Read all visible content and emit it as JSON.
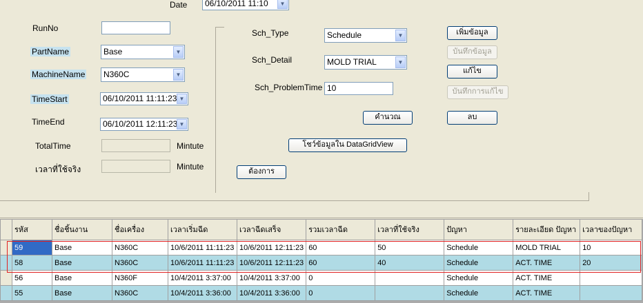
{
  "form": {
    "date_label": "Date",
    "date_value": "06/10/2011 11:10",
    "runno_label": "RunNo",
    "runno_value": "",
    "partname_label": "PartName",
    "partname_value": "Base",
    "machinename_label": "MachineName",
    "machinename_value": "N360C",
    "timestart_label": "TimeStart",
    "timestart_value": "06/10/2011 11:11:23",
    "timeend_label": "TimeEnd",
    "timeend_value": "06/10/2011 12:11:23",
    "totaltime_label": "TotalTime",
    "totaltime_value": "",
    "totaltime_unit": "Mintute",
    "realtime_label": "เวลาที่ใช้จริง",
    "realtime_value": "",
    "realtime_unit": "Mintute",
    "sch_type_label": "Sch_Type",
    "sch_type_value": "Schedule",
    "sch_detail_label": "Sch_Detail",
    "sch_detail_value": "MOLD TRIAL",
    "sch_problemtime_label": "Sch_ProblemTime",
    "sch_problemtime_value": "10"
  },
  "buttons": {
    "add": "เพิ่มข้อมูล",
    "save": "บันทึกข้อมูล",
    "edit": "แก้ไข",
    "save_edit": "บันทึกการแก้ไข",
    "calculate": "คำนวณ",
    "delete": "ลบ",
    "show_grid": "โชว์ข้อมูลใน DataGridView",
    "want": "ต้องการ"
  },
  "grid": {
    "headers": [
      "รหัส",
      "ชื่อชิ้นงาน",
      "ชื่อเครื่อง",
      "เวลาเริ่มฉีด",
      "เวลาฉีดเสร็จ",
      "รวมเวลาฉีด",
      "เวลาที่ใช้จริง",
      "ปัญหา",
      "รายละเอียด ปัญหา",
      "เวลาของปัญหา"
    ],
    "rows": [
      [
        "59",
        "Base",
        "N360C",
        "10/6/2011 11:11:23",
        "10/6/2011 12:11:23",
        "60",
        "50",
        "Schedule",
        "MOLD TRIAL",
        "10"
      ],
      [
        "58",
        "Base",
        "N360C",
        "10/6/2011 11:11:23",
        "10/6/2011 12:11:23",
        "60",
        "40",
        "Schedule",
        "ACT. TIME",
        "20"
      ],
      [
        "56",
        "Base",
        "N360F",
        "10/4/2011 3:37:00",
        "10/4/2011 3:37:00",
        "0",
        "",
        "Schedule",
        "ACT. TIME",
        ""
      ],
      [
        "55",
        "Base",
        "N360C",
        "10/4/2011 3:36:00",
        "10/4/2011 3:36:00",
        "0",
        "",
        "Schedule",
        "ACT. TIME",
        ""
      ]
    ]
  }
}
